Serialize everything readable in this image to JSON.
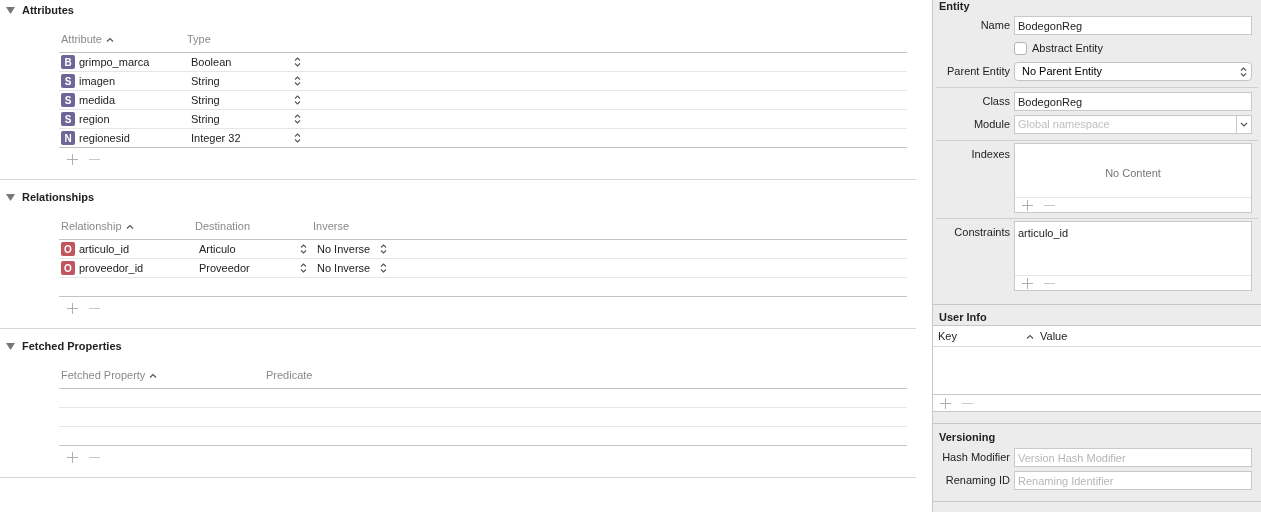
{
  "sections": [
    {
      "title": "Attributes",
      "expanded": true,
      "columns": [
        "Attribute",
        "Type"
      ],
      "rows": [
        {
          "badge": "B",
          "color": "#6c6796",
          "cells": [
            "grimpo_marca",
            "Boolean"
          ]
        },
        {
          "badge": "S",
          "color": "#6c6796",
          "cells": [
            "imagen",
            "String"
          ]
        },
        {
          "badge": "S",
          "color": "#6c6796",
          "cells": [
            "medida",
            "String"
          ]
        },
        {
          "badge": "S",
          "color": "#6c6796",
          "cells": [
            "region",
            "String"
          ]
        },
        {
          "badge": "N",
          "color": "#6c6796",
          "cells": [
            "regionesid",
            "Integer 32"
          ]
        }
      ]
    },
    {
      "title": "Relationships",
      "expanded": true,
      "columns": [
        "Relationship",
        "Destination",
        "Inverse"
      ],
      "rows": [
        {
          "badge": "O",
          "color": "#c2545e",
          "cells": [
            "articulo_id",
            "Articulo",
            "No Inverse"
          ]
        },
        {
          "badge": "O",
          "color": "#c2545e",
          "cells": [
            "proveedor_id",
            "Proveedor",
            "No Inverse"
          ]
        }
      ]
    },
    {
      "title": "Fetched Properties",
      "expanded": true,
      "columns": [
        "Fetched Property",
        "Predicate"
      ]
    }
  ],
  "inspector": {
    "entity": {
      "title": "Entity",
      "name_label": "Name",
      "name": "BodegonReg",
      "abstract": {
        "label": "Abstract Entity",
        "checked": false
      },
      "parent_label": "Parent Entity",
      "parent": "No Parent Entity",
      "class_label": "Class",
      "class": "BodegonReg",
      "module_label": "Module",
      "module_placeholder": "Global namespace",
      "indexes_label": "Indexes",
      "indexes_empty": "No Content",
      "constraints_label": "Constraints",
      "constraints": [
        "articulo_id"
      ]
    },
    "user_info": {
      "title": "User Info",
      "columns": [
        "Key",
        "Value"
      ]
    },
    "versioning": {
      "title": "Versioning",
      "hash_label": "Hash Modifier",
      "hash_placeholder": "Version Hash Modifier",
      "renaming_label": "Renaming ID",
      "renaming_placeholder": "Renaming Identifier"
    }
  }
}
